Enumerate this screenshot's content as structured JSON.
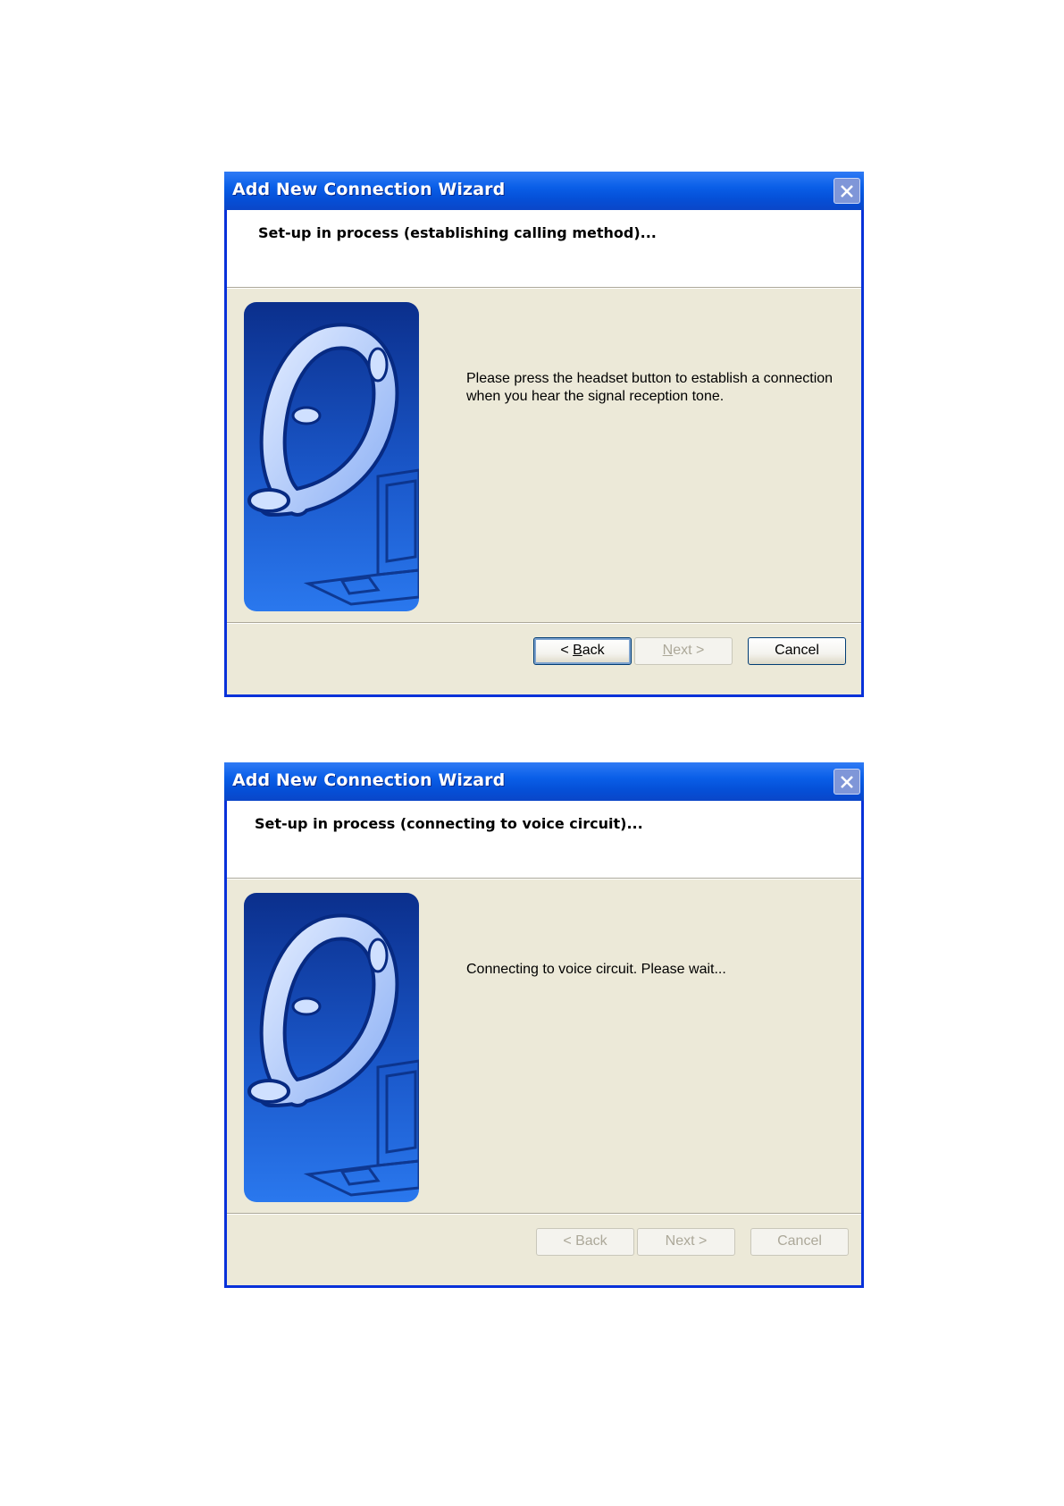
{
  "wizard_1": {
    "title": "Add New Connection Wizard",
    "heading": "Set-up in process (establishing calling method)...",
    "message": "Please press the headset button to establish a connection when you hear the signal reception tone.",
    "buttons": {
      "back": {
        "label": "< Back",
        "accesskey": "B",
        "enabled": true,
        "focused": true
      },
      "next": {
        "label": "Next >",
        "accesskey": "N",
        "enabled": false
      },
      "cancel": {
        "label": "Cancel",
        "enabled": true
      }
    }
  },
  "wizard_2": {
    "title": "Add New Connection Wizard",
    "heading": "Set-up in process (connecting to voice circuit)...",
    "message": "Connecting to voice circuit. Please wait...",
    "buttons": {
      "back": {
        "label": "< Back",
        "enabled": false
      },
      "next": {
        "label": "Next >",
        "enabled": false
      },
      "cancel": {
        "label": "Cancel",
        "enabled": false
      }
    }
  },
  "colors": {
    "titlebar": "#0a5fe8",
    "dialog_bg": "#ece9d8",
    "art_blue": "#1e5ed6",
    "disabled_text": "#aca899"
  },
  "icons": {
    "close": "close-icon",
    "art": "headset-laptop-illustration"
  }
}
